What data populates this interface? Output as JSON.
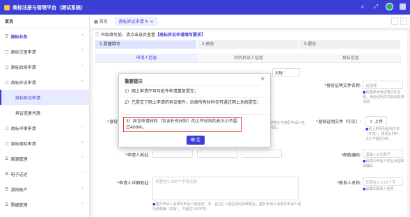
{
  "app": {
    "title": "商标注册与管理平台（测试系统）",
    "icons": [
      "search-icon",
      "fullscreen-icon",
      "avatar-icon",
      "user-icon"
    ]
  },
  "sidebar": {
    "home": "首页",
    "group": "商标业务",
    "items": [
      {
        "label": "商标注册申请"
      },
      {
        "label": "商标后续申请"
      },
      {
        "label": "商标异议申请"
      },
      {
        "label": "商标异议申请"
      },
      {
        "label": "异议变更代理"
      },
      {
        "label": "商标评审申请"
      },
      {
        "label": "商标国际申请"
      },
      {
        "label": "案源管理"
      },
      {
        "label": "电子送达"
      },
      {
        "label": "我的账户"
      },
      {
        "label": "票据管理"
      }
    ]
  },
  "tabs": {
    "home": "首页",
    "active": "商标异议申请",
    "close": "×"
  },
  "notice": {
    "prefix": "开始填写前，请点击该页查看",
    "link": "【商标异议申请填写要求】"
  },
  "steps": [
    "1.数据填写",
    "2.预览",
    "3.提交"
  ],
  "subtabs": [
    "申请人信息",
    "共同异议人信息",
    "商标信息"
  ],
  "form": {
    "lang_select": "大陆",
    "id_type_label": "身份证明文件名称:",
    "id_type_placeholder": "请选择",
    "id_type_hint": "请选择身份证明文件名称。身份证明文件具体名称详情",
    "id_cert_label": "身份证",
    "id_cert_hint": "请使用规范简化字填写申请人名称，如有代码。",
    "id_file_label": "身份证明文件（中文）:",
    "upload_btn": "上传",
    "upload_hint": "请上传身份证明文件（中文），格式为PDF，大小不超过5M。",
    "address_label": "申请人地址:",
    "postcode_label": "邮政编码:",
    "postcode_placeholder": "请输入6位数字",
    "postcode_hint": "请填写申请人地址对应邮政编码",
    "detail_addr_label": "申请人详细地址:",
    "detail_addr_placeholder": "长度在1-200个字符之间",
    "detail_addr_hint": "国内申请人请填写申请人地址省、市、县(区)三级区划的详细地址。国外申请人请填写申请人地址和邮编（如有），不超过100字符。",
    "contact_label": "联系人名称:",
    "contact_placeholder": "长度在1-120个字",
    "contact_hint": "请填写联系人名称"
  },
  "modal": {
    "title": "重要提示",
    "close": "×",
    "line1": "1）网上申请不可与纸件申请重复提交；",
    "line2": "2）已提交了网上申请的异议案件，后续所有材料仅可通过网上系统提交；",
    "line3": "3）异议申请材料（包含补充材料）的上传材料的总大小不超过400M。",
    "ok": "确 定"
  }
}
